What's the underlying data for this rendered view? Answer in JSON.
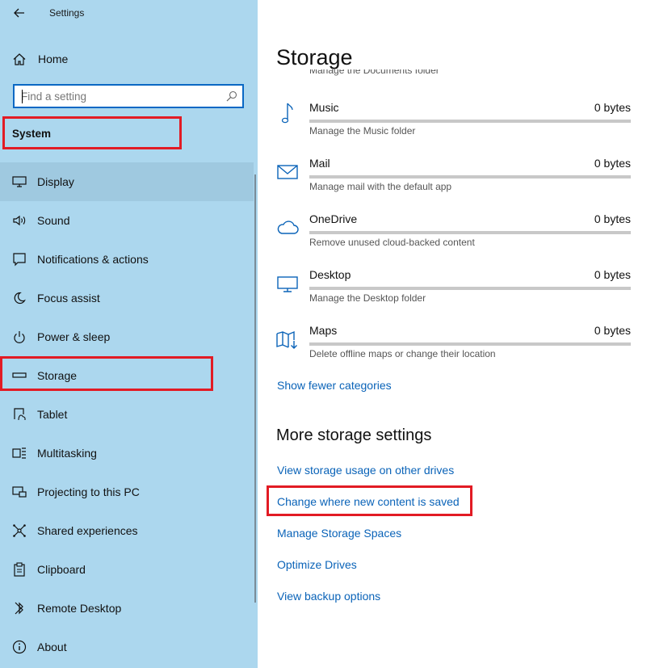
{
  "window": {
    "title": "Settings"
  },
  "sidebar": {
    "home_label": "Home",
    "search": {
      "placeholder": "Find a setting",
      "value": ""
    },
    "section_title": "System",
    "items": [
      {
        "label": "Display",
        "icon": "monitor-icon",
        "active": true
      },
      {
        "label": "Sound",
        "icon": "speaker-icon"
      },
      {
        "label": "Notifications & actions",
        "icon": "notification-icon"
      },
      {
        "label": "Focus assist",
        "icon": "moon-icon"
      },
      {
        "label": "Power & sleep",
        "icon": "power-icon"
      },
      {
        "label": "Storage",
        "icon": "storage-drive-icon"
      },
      {
        "label": "Tablet",
        "icon": "tablet-icon"
      },
      {
        "label": "Multitasking",
        "icon": "multitasking-icon"
      },
      {
        "label": "Projecting to this PC",
        "icon": "projecting-icon"
      },
      {
        "label": "Shared experiences",
        "icon": "shared-experiences-icon"
      },
      {
        "label": "Clipboard",
        "icon": "clipboard-icon"
      },
      {
        "label": "Remote Desktop",
        "icon": "remote-desktop-icon"
      },
      {
        "label": "About",
        "icon": "info-icon"
      }
    ]
  },
  "main": {
    "title": "Storage",
    "partial_text": "Manage the Documents folder",
    "categories": [
      {
        "name": "Music",
        "size": "0 bytes",
        "desc": "Manage the Music folder",
        "icon": "music-note-icon",
        "usage": 0
      },
      {
        "name": "Mail",
        "size": "0 bytes",
        "desc": "Manage mail with the default app",
        "icon": "mail-icon",
        "usage": 0
      },
      {
        "name": "OneDrive",
        "size": "0 bytes",
        "desc": "Remove unused cloud-backed content",
        "icon": "cloud-icon",
        "usage": 0
      },
      {
        "name": "Desktop",
        "size": "0 bytes",
        "desc": "Manage the Desktop folder",
        "icon": "desktop-icon",
        "usage": 0
      },
      {
        "name": "Maps",
        "size": "0 bytes",
        "desc": "Delete offline maps or change their location",
        "icon": "map-icon",
        "usage": 0
      }
    ],
    "show_fewer_link": "Show fewer categories",
    "more_title": "More storage settings",
    "more_links": [
      "View storage usage on other drives",
      "Change where new content is saved",
      "Manage Storage Spaces",
      "Optimize Drives",
      "View backup options"
    ]
  },
  "colors": {
    "sidebar_bg": "#acd7ee",
    "accent": "#0a63b8",
    "highlight": "#e21b24"
  }
}
